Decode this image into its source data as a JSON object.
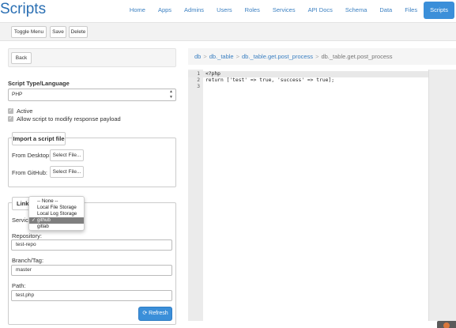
{
  "header": {
    "brand": "Scripts",
    "nav": [
      {
        "label": "Home",
        "active": false
      },
      {
        "label": "Apps",
        "active": false
      },
      {
        "label": "Admins",
        "active": false
      },
      {
        "label": "Users",
        "active": false
      },
      {
        "label": "Roles",
        "active": false
      },
      {
        "label": "Services",
        "active": false
      },
      {
        "label": "API Docs",
        "active": false
      },
      {
        "label": "Schema",
        "active": false
      },
      {
        "label": "Data",
        "active": false
      },
      {
        "label": "Files",
        "active": false
      },
      {
        "label": "Scripts",
        "active": true
      }
    ]
  },
  "toolbar": {
    "toggle_menu_label": "Toggle Menu",
    "save_label": "Save",
    "delete_label": "Delete"
  },
  "left": {
    "back_label": "Back",
    "script_type_label": "Script Type/Language",
    "script_type_value": "PHP",
    "active_label": "Active",
    "active_checked": true,
    "allow_modify_label": "Allow script to modify response payload",
    "allow_modify_checked": true,
    "import": {
      "legend": "Import a script file",
      "from_desktop_label": "From Desktop:",
      "from_github_label": "From GitHub:",
      "select_file_label": "Select File..."
    },
    "link": {
      "legend_partial": "Link t",
      "service_label_partial": "Servic",
      "dropdown_options": [
        "-- None --",
        "Local File Storage",
        "Local Log Storage",
        "github",
        "gitlab"
      ],
      "dropdown_selected": "github",
      "repository_label": "Repository:",
      "repository_value": "test-repo",
      "branch_label": "Branch/Tag:",
      "branch_value": "master",
      "path_label": "Path:",
      "path_value": "test.php",
      "refresh_label": "Refresh",
      "refresh_icon": "refresh-icon"
    }
  },
  "right": {
    "breadcrumb": [
      "db",
      "db._table",
      "db._table.get.post_process",
      "db._table.get.post_process"
    ],
    "editor": {
      "line_numbers": [
        "1",
        "2",
        "3"
      ],
      "lines": [
        "<?php",
        "return ['test' => true, 'success' => true];",
        ""
      ]
    }
  },
  "colors": {
    "brand": "#2a6fb3",
    "nav_link": "#3a7fc1",
    "nav_active_bg": "#3b8fd9",
    "primary_button": "#3b8fd9",
    "dropdown_selected_bg": "#7f7f7f"
  }
}
